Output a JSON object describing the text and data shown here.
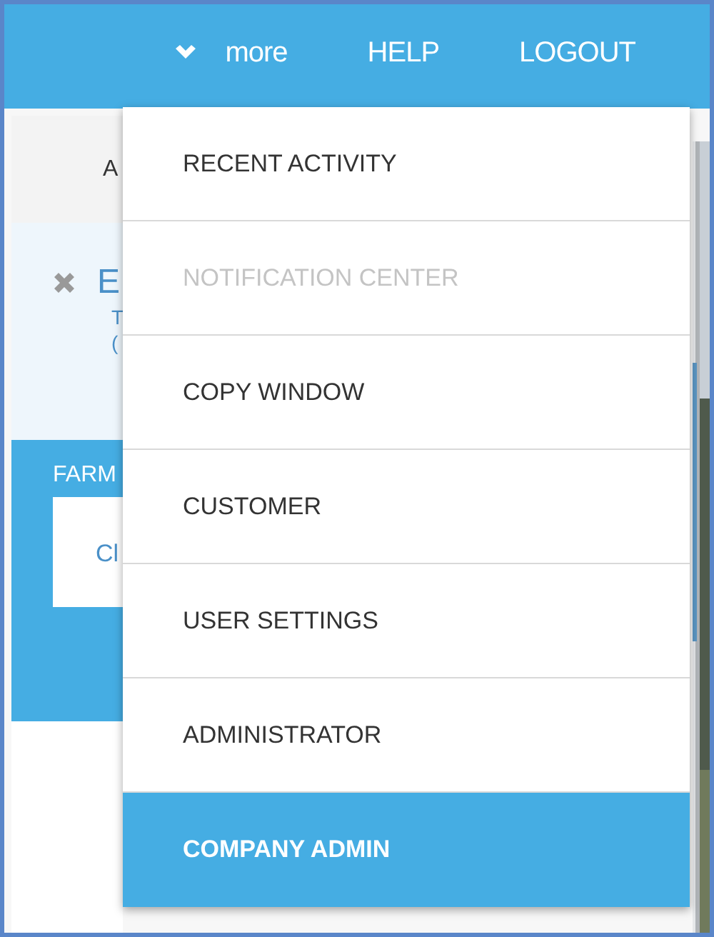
{
  "header": {
    "nav": [
      {
        "label": "more",
        "kind": "dropdown"
      },
      {
        "label": "HELP",
        "kind": "link"
      },
      {
        "label": "LOGOUT",
        "kind": "link"
      }
    ]
  },
  "background": {
    "tab_label": "A",
    "title": "E",
    "line_1": "T",
    "line_2": "(",
    "section_label": "FARM",
    "button_label": "Cl"
  },
  "menu": {
    "items": [
      {
        "label": "RECENT ACTIVITY",
        "disabled": false,
        "selected": false
      },
      {
        "label": "NOTIFICATION CENTER",
        "disabled": true,
        "selected": false
      },
      {
        "label": "COPY WINDOW",
        "disabled": false,
        "selected": false
      },
      {
        "label": "CUSTOMER",
        "disabled": false,
        "selected": false
      },
      {
        "label": "USER SETTINGS",
        "disabled": false,
        "selected": false
      },
      {
        "label": "ADMINISTRATOR",
        "disabled": false,
        "selected": false
      },
      {
        "label": "COMPANY ADMIN",
        "disabled": false,
        "selected": true
      }
    ]
  }
}
